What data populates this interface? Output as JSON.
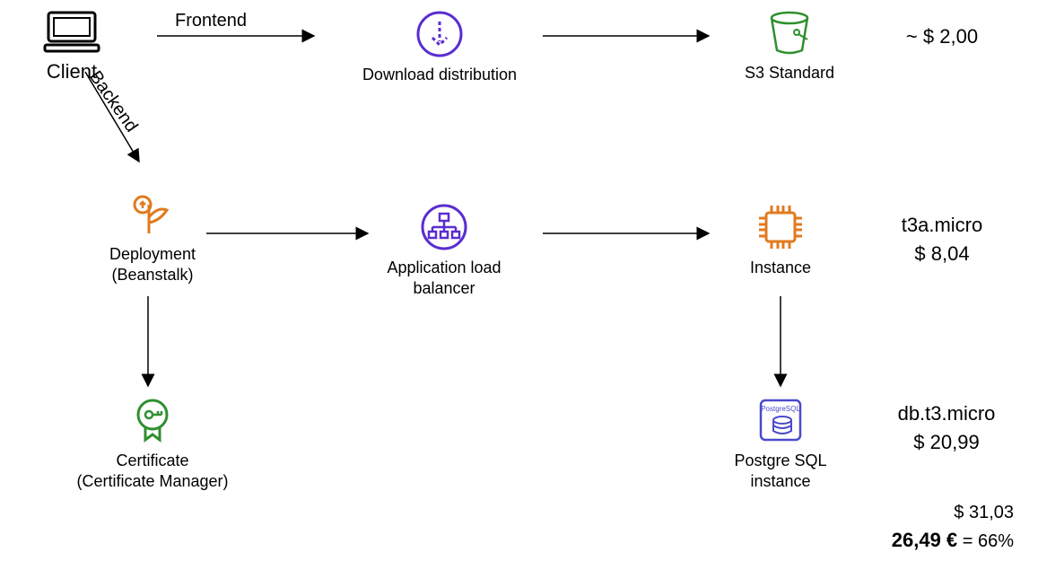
{
  "nodes": {
    "client": {
      "label": "Client"
    },
    "download_distribution": {
      "label": "Download distribution"
    },
    "s3_standard": {
      "label": "S3 Standard"
    },
    "deployment": {
      "label": "Deployment\n(Beanstalk)"
    },
    "alb": {
      "label": "Application load balancer"
    },
    "instance": {
      "label": "Instance"
    },
    "certificate": {
      "label": "Certificate\n(Certificate Manager)"
    },
    "postgres": {
      "label": "Postgre SQL\ninstance",
      "icon_text": "PostgreSQL"
    }
  },
  "edges": {
    "frontend": {
      "label": "Frontend"
    },
    "backend": {
      "label": "Backend"
    }
  },
  "prices": {
    "s3": {
      "approx": "~ $ 2,00"
    },
    "instance": {
      "type": "t3a.micro",
      "cost": "$ 8,04"
    },
    "db": {
      "type": "db.t3.micro",
      "cost": "$ 20,99"
    },
    "subtotal": "$ 31,03",
    "total_eur": "26,49 €",
    "total_pct": " = 66%"
  }
}
